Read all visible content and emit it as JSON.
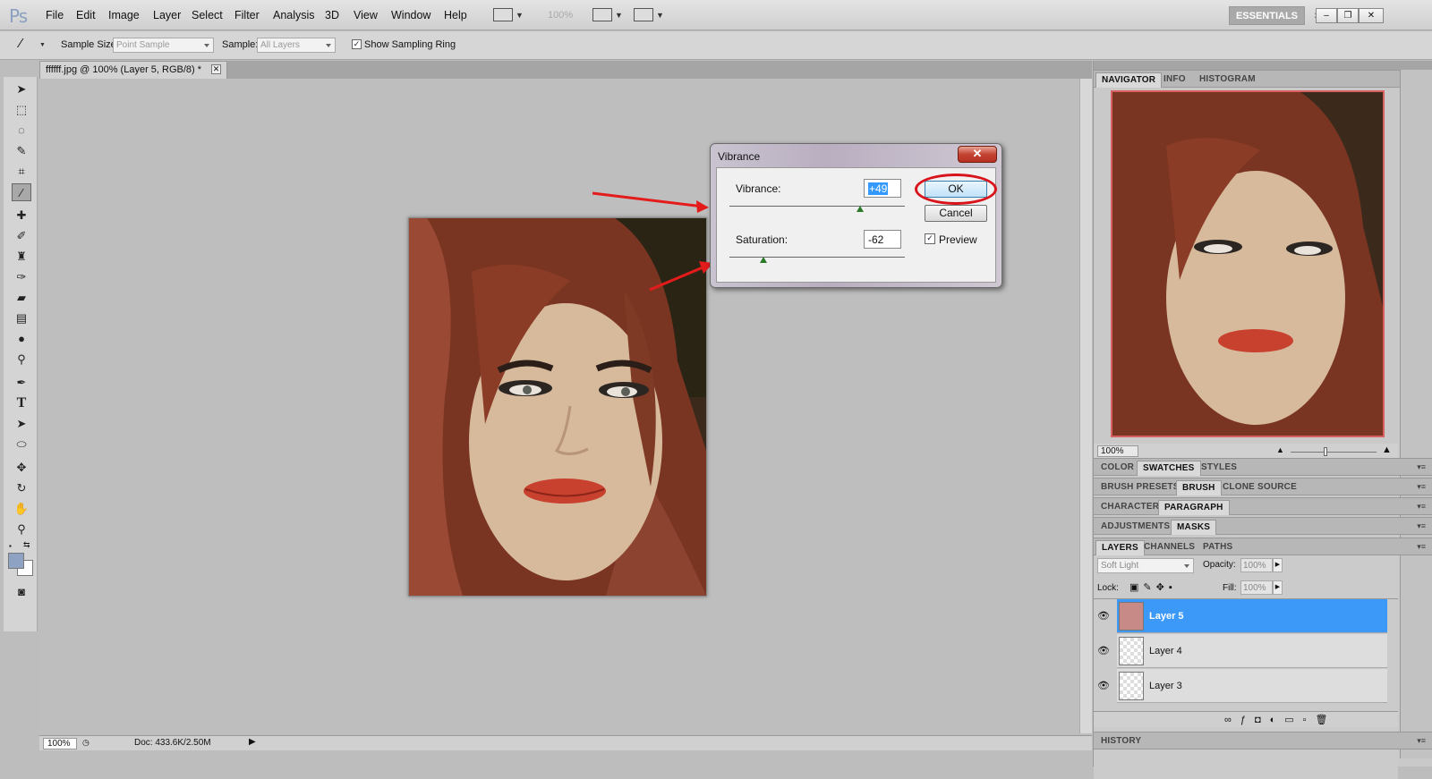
{
  "menubar": {
    "logo": "Ps",
    "items": [
      "File",
      "Edit",
      "Image",
      "Layer",
      "Select",
      "Filter",
      "Analysis",
      "3D",
      "View",
      "Window",
      "Help"
    ],
    "zoom": "100%",
    "workspace": "ESSENTIALS",
    "chevron": "»"
  },
  "options": {
    "sample_size_label": "Sample Size:",
    "sample_size_value": "Point Sample",
    "sample_label": "Sample:",
    "sample_value": "All Layers",
    "sampling_ring_label": "Show Sampling Ring",
    "sampling_ring_checked": true
  },
  "document": {
    "tab_title": "ffffff.jpg @ 100% (Layer 5, RGB/8) *",
    "status_zoom": "100%",
    "status_doc": "Doc: 433.6K/2.50M"
  },
  "dialog": {
    "title": "Vibrance",
    "vibrance_label": "Vibrance:",
    "vibrance_value": "+49",
    "saturation_label": "Saturation:",
    "saturation_value": "-62",
    "ok_label": "OK",
    "cancel_label": "Cancel",
    "preview_label": "Preview",
    "preview_checked": true
  },
  "panels": {
    "navigator_tabs": [
      "NAVIGATOR",
      "INFO",
      "HISTOGRAM"
    ],
    "nav_zoom": "100%",
    "color_tabs": [
      "COLOR",
      "SWATCHES",
      "STYLES"
    ],
    "brush_tabs": [
      "BRUSH PRESETS",
      "BRUSH",
      "CLONE SOURCE"
    ],
    "text_tabs": [
      "CHARACTER",
      "PARAGRAPH"
    ],
    "adjust_tabs": [
      "ADJUSTMENTS",
      "MASKS"
    ],
    "layer_tabs": [
      "LAYERS",
      "CHANNELS",
      "PATHS"
    ],
    "blend_mode": "Soft Light",
    "opacity_label": "Opacity:",
    "opacity_value": "100%",
    "lock_label": "Lock:",
    "fill_label": "Fill:",
    "fill_value": "100%",
    "layers": [
      "Layer 5",
      "Layer 4",
      "Layer 3"
    ],
    "history_label": "HISTORY"
  },
  "colors": {
    "accent": "#3c99f8",
    "annotation_red": "#e31b1b",
    "foreground": "#8ea2c4",
    "background": "#ffffff"
  }
}
